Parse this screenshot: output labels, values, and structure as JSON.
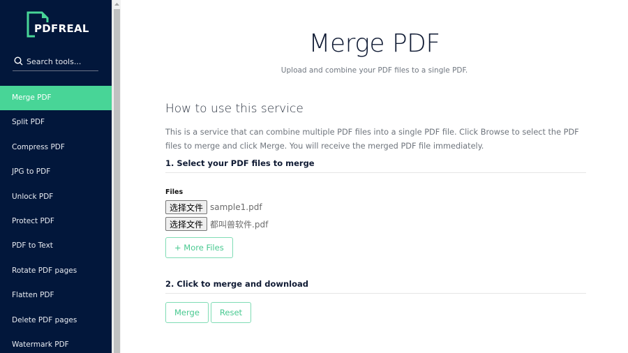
{
  "brand": {
    "name": "PDFREAL",
    "accent_color": "#48d597",
    "sidebar_color": "#02173b"
  },
  "sidebar": {
    "search_placeholder": "Search tools...",
    "items": [
      {
        "label": "Merge PDF",
        "active": true
      },
      {
        "label": "Split PDF",
        "active": false
      },
      {
        "label": "Compress PDF",
        "active": false
      },
      {
        "label": "JPG to PDF",
        "active": false
      },
      {
        "label": "Unlock PDF",
        "active": false
      },
      {
        "label": "Protect PDF",
        "active": false
      },
      {
        "label": "PDF to Text",
        "active": false
      },
      {
        "label": "Rotate PDF pages",
        "active": false
      },
      {
        "label": "Flatten PDF",
        "active": false
      },
      {
        "label": "Delete PDF pages",
        "active": false
      },
      {
        "label": "Watermark PDF",
        "active": false
      }
    ]
  },
  "header": {
    "title": "Merge PDF",
    "subtitle": "Upload and combine your PDF files to a single PDF."
  },
  "howto": {
    "title": "How to use this service",
    "description": "This is a service that can combine multiple PDF files into a single PDF file. Click Browse to select the PDF files to merge and click Merge. You will receive the merged PDF file immediately."
  },
  "step1": {
    "heading": "1. Select your PDF files to merge",
    "files_label": "Files",
    "files": [
      {
        "button_label": "选择文件",
        "file_name": "sample1.pdf"
      },
      {
        "button_label": "选择文件",
        "file_name": "都叫兽软件.pdf"
      }
    ],
    "more_files_label": "+ More Files"
  },
  "step2": {
    "heading": "2. Click to merge and download",
    "merge_label": "Merge",
    "reset_label": "Reset"
  }
}
